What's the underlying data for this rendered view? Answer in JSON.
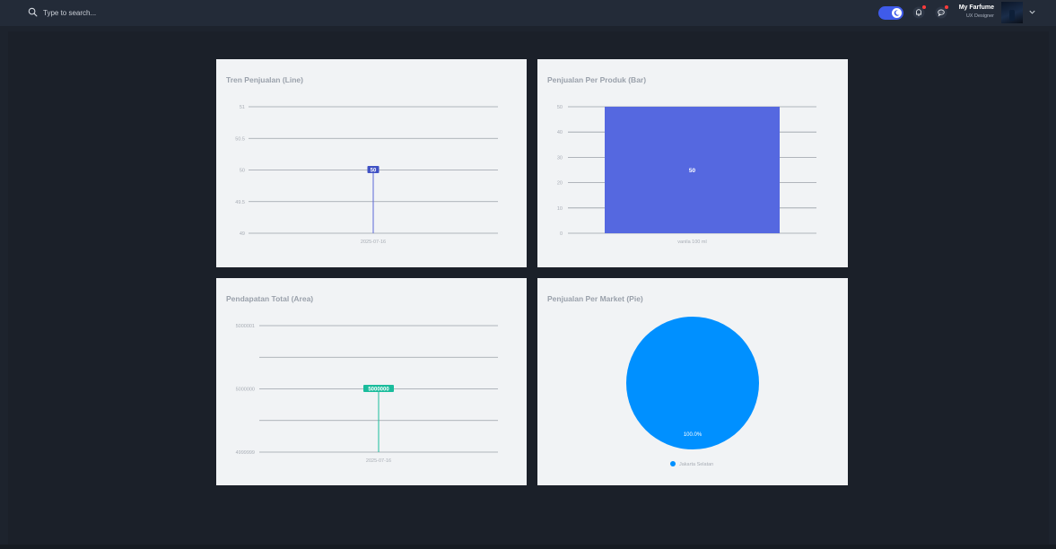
{
  "search": {
    "placeholder": "Type to search..."
  },
  "header": {
    "user_name": "My Farfume",
    "user_role": "UX Designer",
    "theme_toggle": "dark"
  },
  "cards": {
    "line": {
      "title": "Tren Penjualan (Line)"
    },
    "bar": {
      "title": "Penjualan Per Produk (Bar)"
    },
    "area": {
      "title": "Pendapatan Total (Area)"
    },
    "pie": {
      "title": "Penjualan Per Market (Pie)"
    }
  },
  "colors": {
    "line": "#5a67d8",
    "bar": "#5568e0",
    "area": "#1abc9c",
    "pie": "#0090ff"
  },
  "chart_data": [
    {
      "type": "line",
      "title": "Tren Penjualan (Line)",
      "x": [
        "2025-07-16"
      ],
      "series": [
        {
          "values": [
            50
          ]
        }
      ],
      "yticks": [
        "51",
        "50.5",
        "50",
        "49.5",
        "49"
      ],
      "ylim": [
        49,
        51
      ],
      "data_labels": [
        "50"
      ],
      "grid": true
    },
    {
      "type": "bar",
      "title": "Penjualan Per Produk (Bar)",
      "categories": [
        "vanila 100 ml"
      ],
      "values": [
        50
      ],
      "yticks": [
        "50",
        "40",
        "30",
        "20",
        "10",
        "0"
      ],
      "ylim": [
        0,
        50
      ],
      "data_labels": [
        "50"
      ],
      "grid": true
    },
    {
      "type": "area",
      "title": "Pendapatan Total (Area)",
      "x": [
        "2025-07-16"
      ],
      "series": [
        {
          "values": [
            5000000
          ]
        }
      ],
      "yticks": [
        "5000001",
        "",
        "5000000",
        "",
        "4999999"
      ],
      "ylim": [
        4999999,
        5000001
      ],
      "data_labels": [
        "5000000"
      ],
      "grid": true
    },
    {
      "type": "pie",
      "title": "Penjualan Per Market (Pie)",
      "labels": [
        "Jakarta Selatan"
      ],
      "values": [
        100
      ],
      "data_labels": [
        "100.0%"
      ],
      "legend": "bottom"
    }
  ]
}
